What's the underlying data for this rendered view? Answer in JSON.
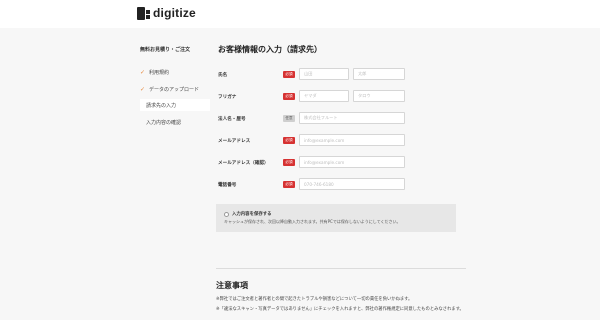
{
  "header": {
    "logo_text": "digitize"
  },
  "sidebar": {
    "title": "無料お見積り・ご注文",
    "steps": [
      {
        "label": "利用規約",
        "done": true
      },
      {
        "label": "データのアップロード",
        "done": true
      },
      {
        "label": "請求先の入力",
        "active": true
      },
      {
        "label": "入力内容の確認"
      }
    ]
  },
  "form": {
    "title": "お客様情報の入力（請求先）",
    "required_badge": "必須",
    "optional_badge": "任意",
    "rows": {
      "name": {
        "label": "氏名",
        "placeholder_last": "山田",
        "placeholder_first": "太郎"
      },
      "furigana": {
        "label": "フリガナ",
        "placeholder_last": "ヤマダ",
        "placeholder_first": "タロウ"
      },
      "company": {
        "label": "法人名・屋号",
        "placeholder": "株式会社フルート"
      },
      "email": {
        "label": "メールアドレス",
        "placeholder": "info@example.com"
      },
      "email_confirm": {
        "label": "メールアドレス（確認）",
        "placeholder": "info@example.com"
      },
      "phone": {
        "label": "電話番号",
        "placeholder": "070-746-6180"
      }
    },
    "save": {
      "title": "入力内容を保存する",
      "description": "キャッシュが保存され、次回以降自動入力されます。共有PCでは保存しないようにしてください。"
    }
  },
  "notes": {
    "title": "注意事項",
    "lines": [
      "※弊社ではご注文者と著作者との間で起きたトラブルや損害などについて一切の責任を負いかねます。",
      "※「違法なスキャン・写真データではありません」にチェックを入れますと、弊社の著作権規定に同意したものとみなされます。"
    ]
  }
}
